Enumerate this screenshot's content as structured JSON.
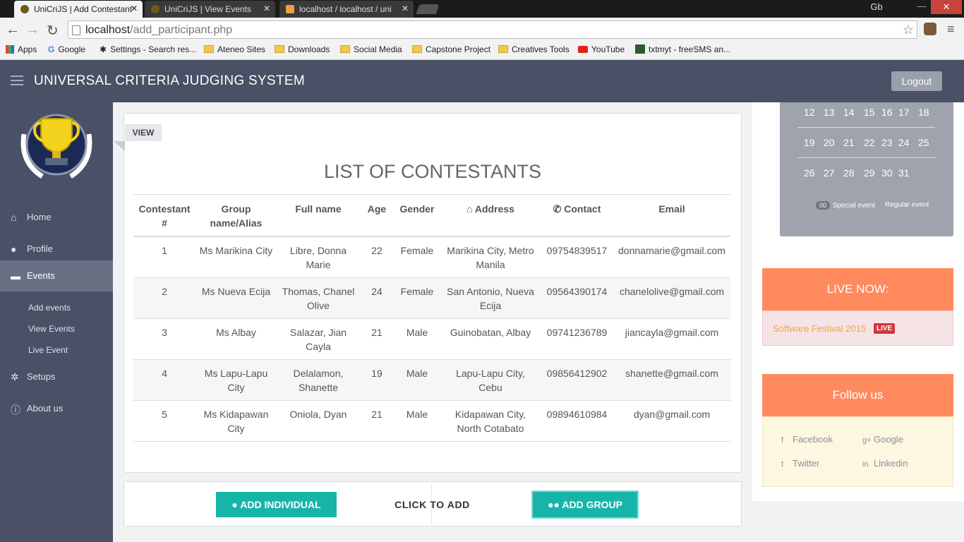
{
  "browser": {
    "tabs": [
      {
        "title": "UniCriJS | Add Contestant",
        "active": true
      },
      {
        "title": "UniCriJS | View Events",
        "active": false
      },
      {
        "title": "localhost / localhost / uni",
        "active": false
      }
    ],
    "tab_close": "✕",
    "window_controls": {
      "profile": "Gb",
      "minimize": "—",
      "maximize": "☐",
      "close": "✕"
    },
    "url_host": "localhost",
    "url_path": "/add_participant.php",
    "bookmarks": [
      "Apps",
      "Google",
      "Settings - Search res...",
      "Ateneo Sites",
      "Downloads",
      "Social Media",
      "Capstone Project",
      "Creatives Tools",
      "YouTube",
      "txtmyt - freeSMS an..."
    ]
  },
  "app": {
    "title": "UNIVERSAL CRITERIA JUDGING SYSTEM",
    "logout_label": "Logout"
  },
  "sidebar": {
    "items": [
      {
        "label": "Home",
        "icon": "home-icon"
      },
      {
        "label": "Profile",
        "icon": "user-icon"
      },
      {
        "label": "Events",
        "icon": "folder-icon",
        "active": true
      },
      {
        "label": "Setups",
        "icon": "gears-icon"
      },
      {
        "label": "About us",
        "icon": "info-icon"
      }
    ],
    "sub_items": [
      "Add events",
      "View Events",
      "Live Event"
    ]
  },
  "main": {
    "view_tag": "VIEW",
    "list_title": "LIST OF CONTESTANTS",
    "columns": [
      "Contestant #",
      "Group name/Alias",
      "Full name",
      "Age",
      "Gender",
      "Address",
      "Contact",
      "Email"
    ],
    "rows": [
      [
        "1",
        "Ms Marikina City",
        "Libre, Donna Marie",
        "22",
        "Female",
        "Marikina City, Metro Manila",
        "09754839517",
        "donnamarie@gmail.com"
      ],
      [
        "2",
        "Ms Nueva Ecija",
        "Thomas, Chanel Olive",
        "24",
        "Female",
        "San Antonio, Nueva Ecija",
        "09564390174",
        "chanelolive@gmail.com"
      ],
      [
        "3",
        "Ms Albay",
        "Salazar, Jian Cayla",
        "21",
        "Male",
        "Guinobatan, Albay",
        "09741236789",
        "jiancayla@gmail.com"
      ],
      [
        "4",
        "Ms Lapu-Lapu City",
        "Delalamon, Shanette",
        "19",
        "Male",
        "Lapu-Lapu City, Cebu",
        "09856412902",
        "shanette@gmail.com"
      ],
      [
        "5",
        "Ms Kidapawan City",
        "Oniola, Dyan",
        "21",
        "Male",
        "Kidapawan City, North Cotabato",
        "09894610984",
        "dyan@gmail.com"
      ]
    ],
    "add_individual_label": "ADD INDIVIDUAL",
    "click_to_add": "CLICK TO ADD",
    "add_group_label": "ADD GROUP"
  },
  "calendar": {
    "weeks": [
      [
        "12",
        "13",
        "14",
        "15",
        "16",
        "17",
        "18"
      ],
      [
        "19",
        "20",
        "21",
        "22",
        "23",
        "24",
        "25"
      ],
      [
        "26",
        "27",
        "28",
        "29",
        "30",
        "31"
      ]
    ],
    "legend_badge": "00",
    "legend_special": "Special event",
    "legend_regular": "Regular event"
  },
  "live": {
    "heading": "LIVE NOW:",
    "event": "Software Festival 2015",
    "badge": "LIVE"
  },
  "follow": {
    "heading": "Follow us",
    "links": [
      "Facebook",
      "Google",
      "Twitter",
      "Linkedin"
    ]
  },
  "colors": {
    "header_bg": "#4a5065",
    "teal": "#17b5a9",
    "orange": "#ff8a5e",
    "live_red": "#d0373a"
  }
}
